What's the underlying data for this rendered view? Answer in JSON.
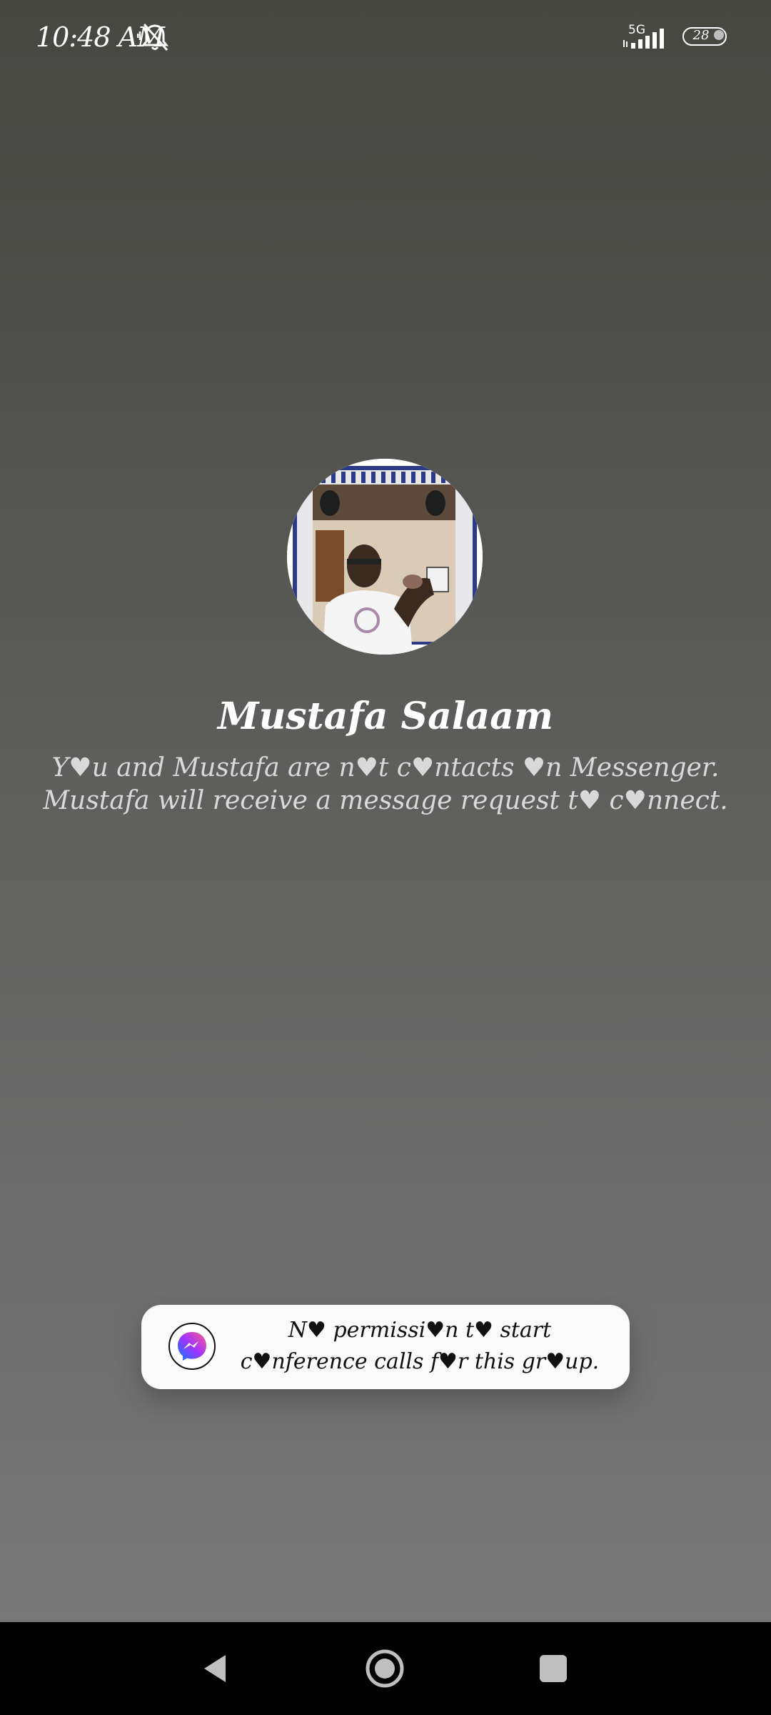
{
  "status_bar": {
    "time": "10:48 AM",
    "network": "5G",
    "battery": "28",
    "icons": [
      "mute-icon",
      "signal-icon",
      "battery-icon"
    ]
  },
  "contact": {
    "name": "Mustafa Salaam",
    "info": "Y♥u and Mustafa are n♥t c♥ntacts ♥n Messenger. Mustafa will receive a message request t♥ c♥nnect."
  },
  "toast": {
    "icon": "messenger-icon",
    "message": "N♥ permissi♥n t♥ start c♥nference calls f♥r this gr♥up."
  },
  "nav_bar": {
    "icons": [
      "back-icon",
      "home-icon",
      "recents-icon"
    ]
  },
  "colors": {
    "background_top": "#474742",
    "background_bottom": "#7a7a7a",
    "toast_background": "#fbfbfb",
    "nav_background": "#000000"
  }
}
